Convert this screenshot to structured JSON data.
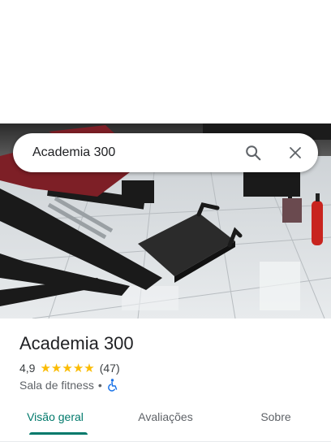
{
  "search": {
    "query": "Academia 300"
  },
  "icons": {
    "search": "search-icon",
    "close": "close-icon",
    "accessibility": "wheelchair-accessible-icon"
  },
  "place": {
    "name": "Academia 300",
    "rating": "4,9",
    "stars": [
      "★",
      "★",
      "★",
      "★",
      "★"
    ],
    "review_count": "(47)",
    "category": "Sala de fitness",
    "separator": "•"
  },
  "tabs": [
    {
      "label": "Visão geral",
      "active": true
    },
    {
      "label": "Avaliações",
      "active": false
    },
    {
      "label": "Sobre",
      "active": false
    }
  ],
  "colors": {
    "accent": "#00796b",
    "star": "#fbbc04",
    "accessibility": "#1a73e8"
  }
}
